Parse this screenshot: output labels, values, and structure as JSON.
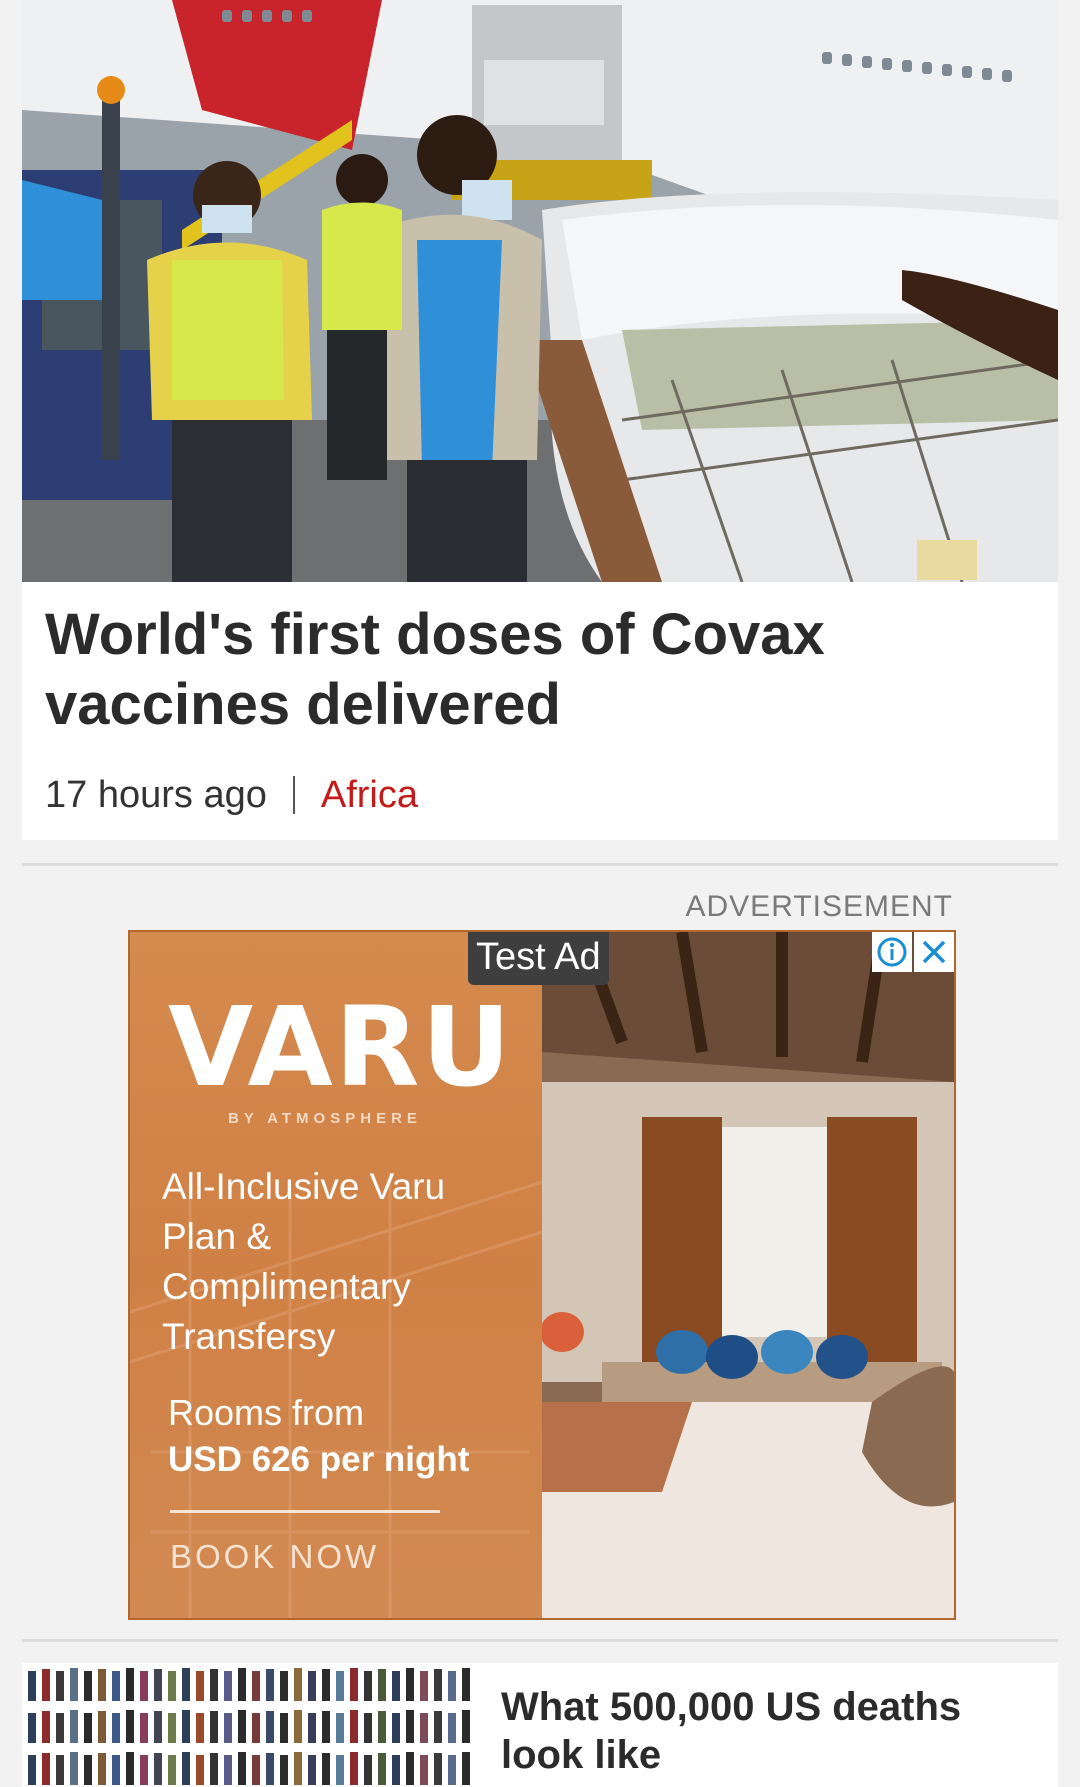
{
  "top_story": {
    "headline": "World's first doses of Covax vaccines delivered",
    "time_ago": "17 hours ago",
    "category": "Africa"
  },
  "advertisement": {
    "label": "ADVERTISEMENT",
    "test_badge": "Test Ad",
    "brand": "VARU",
    "brand_sub": "BY ATMOSPHERE",
    "tagline": "All-Inclusive Varu Plan & Complimentary Transfersy",
    "price_label": "Rooms from",
    "price_value": "USD 626 per night",
    "cta": "BOOK NOW",
    "info_icon": "info-icon",
    "close_icon": "close-icon"
  },
  "next_story": {
    "headline": "What 500,000 US deaths look like"
  },
  "colors": {
    "category": "#c41a1a",
    "ad_orange": "#d58a4e",
    "ad_control_blue": "#1a8fd6"
  }
}
